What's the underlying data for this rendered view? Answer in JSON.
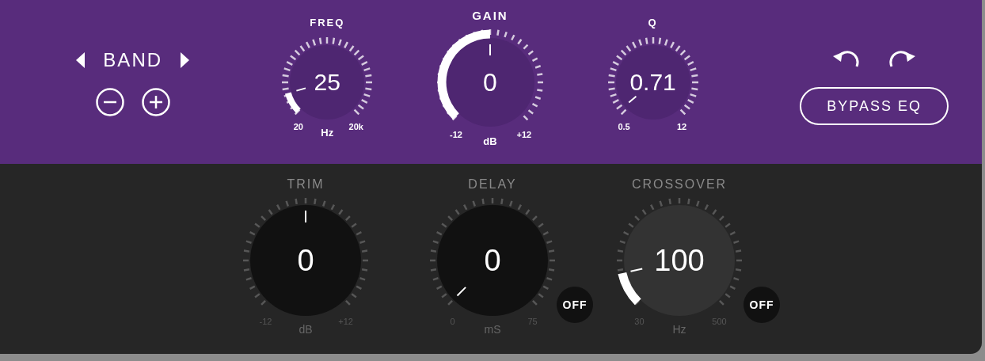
{
  "band": {
    "label": "BAND"
  },
  "eq_knobs": [
    {
      "title": "FREQ",
      "value": "25",
      "min": "20",
      "max": "20k",
      "unit": "Hz",
      "fill_arc": true
    },
    {
      "title": "GAIN",
      "value": "0",
      "min": "-12",
      "max": "+12",
      "unit": "dB",
      "fill_arc": true
    },
    {
      "title": "Q",
      "value": "0.71",
      "min": "0.5",
      "max": "12",
      "fill_arc": false
    }
  ],
  "bypass": {
    "label": "BYPASS EQ",
    "on": false
  },
  "output_knobs": [
    {
      "title": "TRIM",
      "value": "0",
      "min": "-12",
      "max": "+12",
      "unit": "dB",
      "fill_arc": false
    },
    {
      "title": "DELAY",
      "value": "0",
      "min": "0",
      "max": "75",
      "unit": "mS",
      "fill_arc": false,
      "switch": {
        "label": "OFF",
        "on": false
      }
    },
    {
      "title": "CROSSOVER",
      "value": "100",
      "min": "30",
      "max": "500",
      "unit": "Hz",
      "fill_arc": true,
      "switch": {
        "label": "OFF",
        "on": false
      }
    }
  ]
}
